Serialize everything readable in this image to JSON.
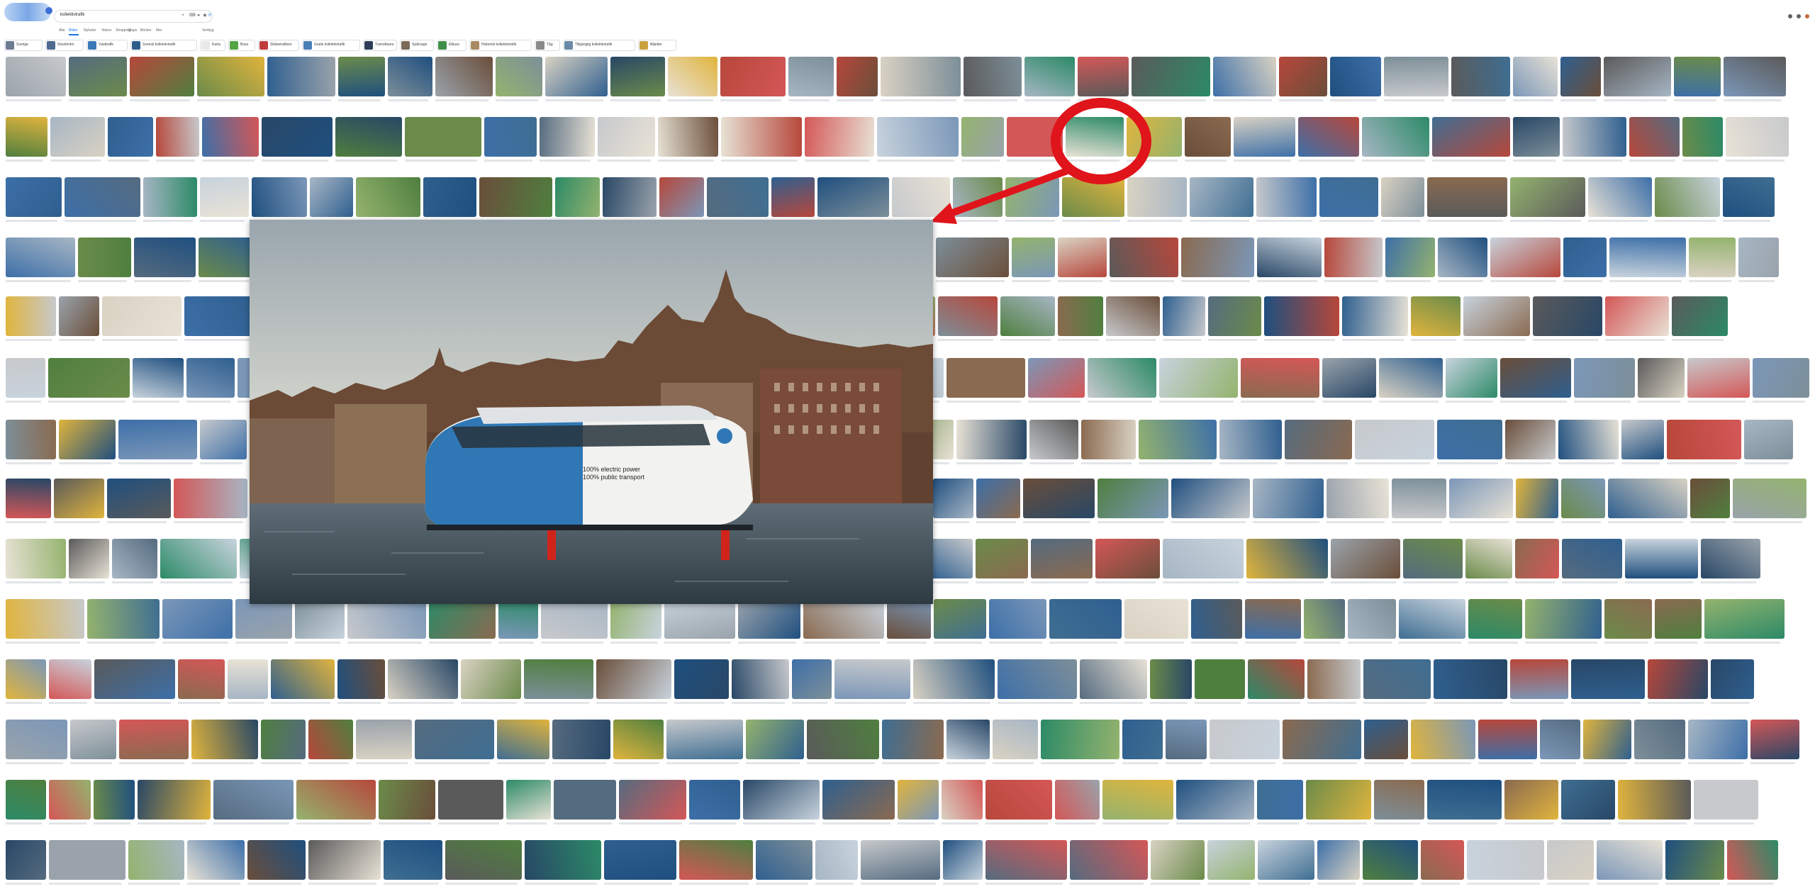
{
  "search": {
    "query": "kollektivtrafik"
  },
  "tabs": [
    {
      "label": "Alla",
      "active": false
    },
    {
      "label": "Bilder",
      "active": true
    },
    {
      "label": "Nyheter",
      "active": false
    },
    {
      "label": "Videor",
      "active": false
    },
    {
      "label": "Shopping",
      "active": false
    },
    {
      "label": "Maps",
      "active": false
    },
    {
      "label": "Böcker",
      "active": false
    },
    {
      "label": "Mer",
      "active": false
    },
    {
      "label": "Verktyg",
      "active": false
    }
  ],
  "chips": [
    {
      "label": "Sverige",
      "color": "#6d7b93"
    },
    {
      "label": "Stockholm",
      "color": "#4d6a8f"
    },
    {
      "label": "Västtrafik",
      "color": "#3a78b8"
    },
    {
      "label": "Svensk kollektivtrafik",
      "color": "#2f5d8a"
    },
    {
      "label": "Karta",
      "color": "#e8e8e8"
    },
    {
      "label": "Buss",
      "color": "#54a545"
    },
    {
      "label": "Skånetrafiken",
      "color": "#c23b3b"
    },
    {
      "label": "Gratis kollektivtrafik",
      "color": "#4a7fb8"
    },
    {
      "label": "Tunnelbana",
      "color": "#2f3e58"
    },
    {
      "label": "Spårvagn",
      "color": "#7d6a58"
    },
    {
      "label": "Elbuss",
      "color": "#3f8f4a"
    },
    {
      "label": "Historisk kollektivtrafik",
      "color": "#a98a62"
    },
    {
      "label": "Tåg",
      "color": "#8a8a8a"
    },
    {
      "label": "Tillgänglig kollektivtrafik",
      "color": "#6a8aa8"
    },
    {
      "label": "Biljetter",
      "color": "#c9a23f"
    }
  ],
  "preview": {
    "text_line1": "100% electric power",
    "text_line2": "100% public transport"
  },
  "annotation": {
    "color": "#e0141b"
  }
}
